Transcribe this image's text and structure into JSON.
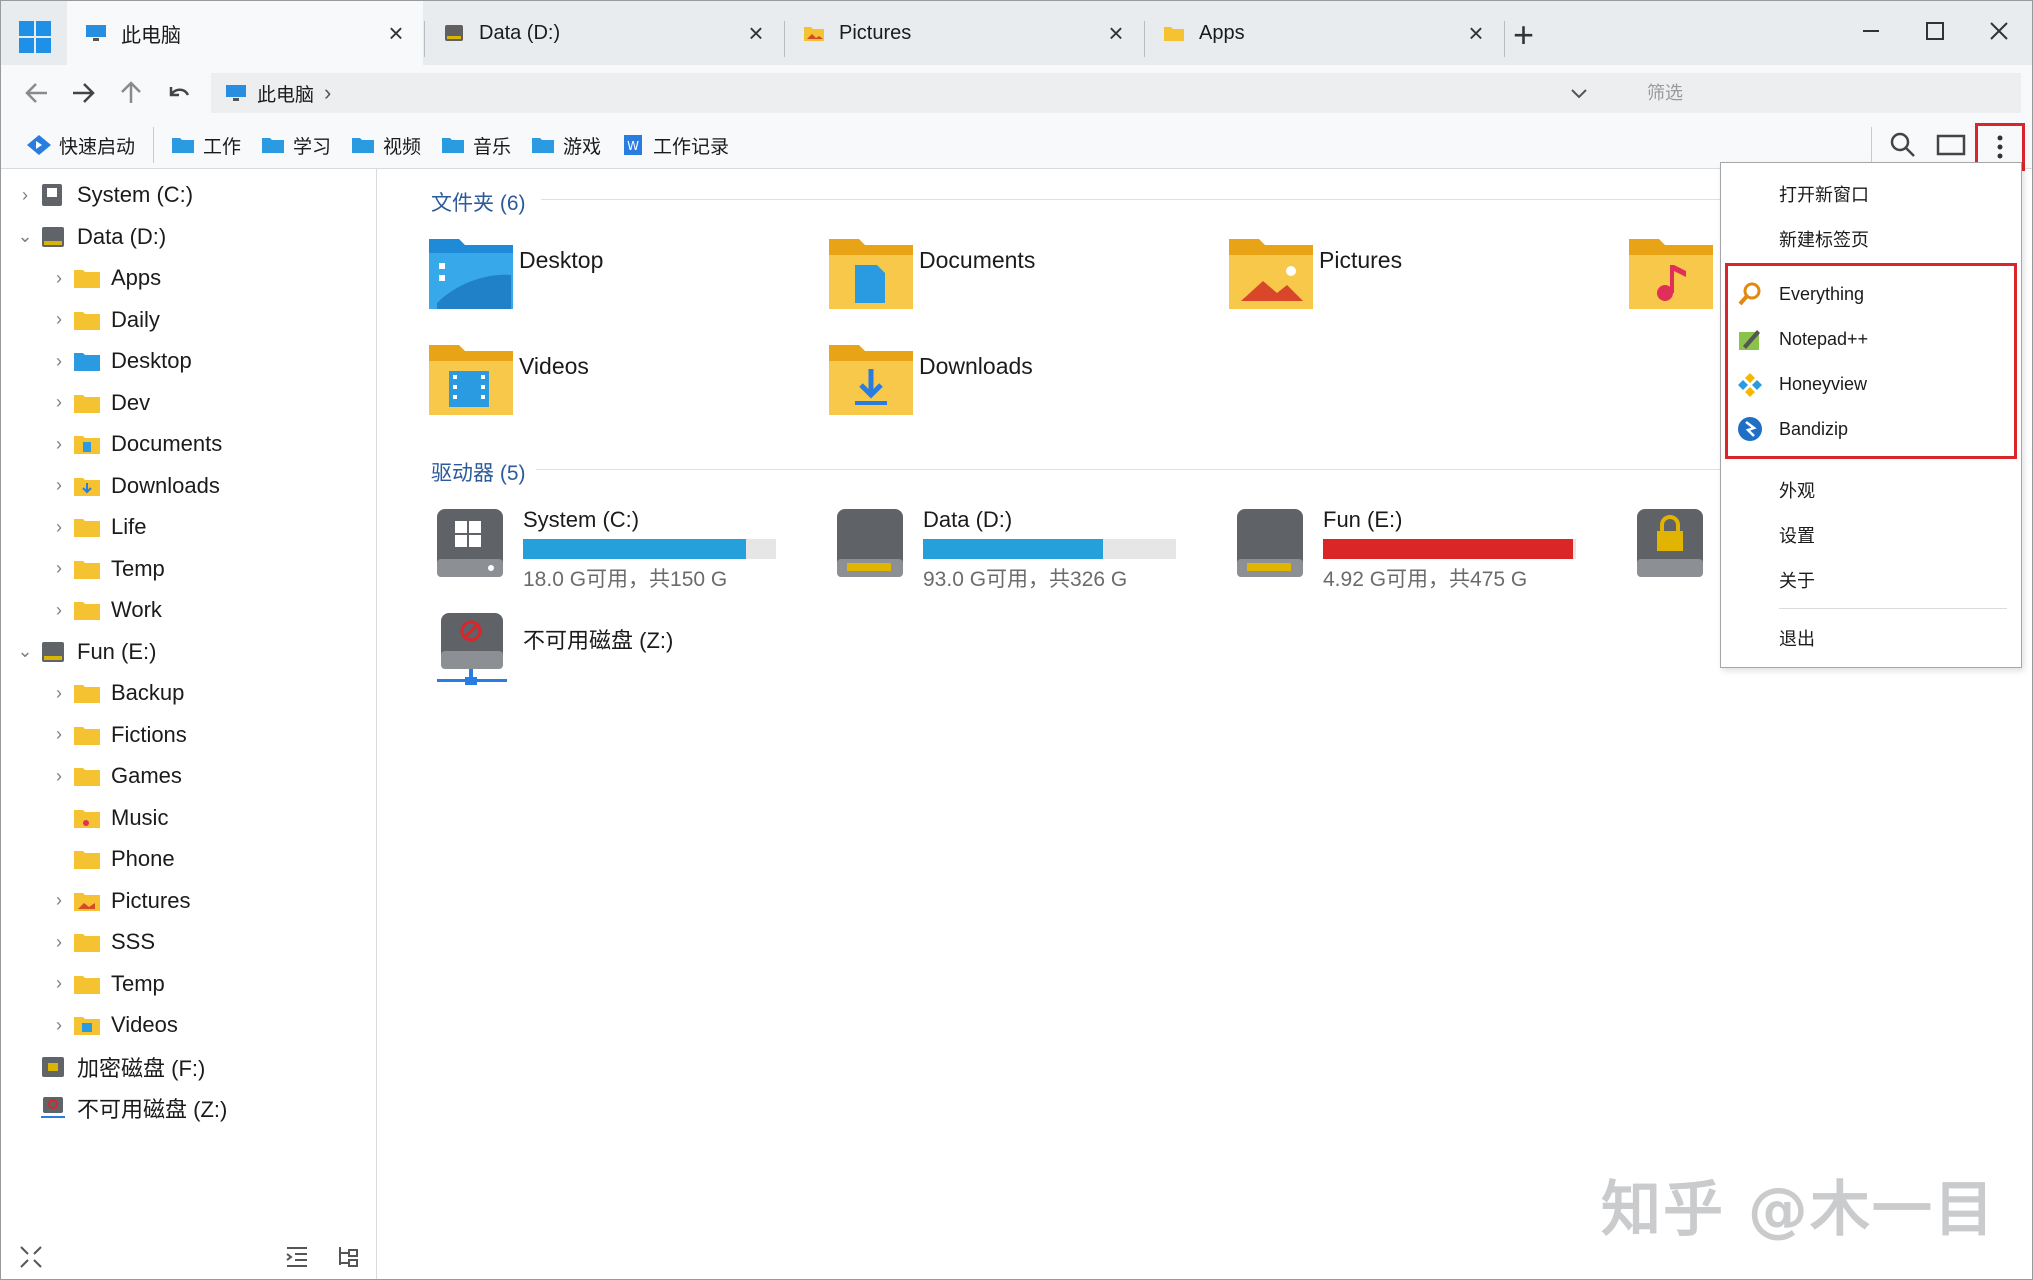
{
  "tabs": [
    {
      "label": "此电脑",
      "icon": "monitor-icon"
    },
    {
      "label": "Data (D:)",
      "icon": "drive-icon"
    },
    {
      "label": "Pictures",
      "icon": "folder-pictures-icon"
    },
    {
      "label": "Apps",
      "icon": "folder-icon"
    }
  ],
  "new_tab": "+",
  "nav": {
    "address": "此电脑",
    "filter_placeholder": "筛选"
  },
  "bookmarks": [
    "快速启动",
    "工作",
    "学习",
    "视频",
    "音乐",
    "游戏",
    "工作记录"
  ],
  "tree": {
    "drive_c": "System (C:)",
    "drive_d": "Data (D:)",
    "d_children": [
      "Apps",
      "Daily",
      "Desktop",
      "Dev",
      "Documents",
      "Downloads",
      "Life",
      "Temp",
      "Work"
    ],
    "drive_e": "Fun (E:)",
    "e_children": [
      "Backup",
      "Fictions",
      "Games",
      "Music",
      "Phone",
      "Pictures",
      "SSS",
      "Temp",
      "Videos"
    ],
    "drive_f": "加密磁盘 (F:)",
    "drive_z": "不可用磁盘 (Z:)"
  },
  "content": {
    "folders_title": "文件夹 (6)",
    "folders": [
      "Desktop",
      "Documents",
      "Pictures",
      "Videos",
      "Downloads"
    ],
    "drives_title": "驱动器 (5)",
    "drives": [
      {
        "label": "System (C:)",
        "free": "18.0 G可用，共150 G",
        "used_fraction": 0.88,
        "color": "#26a0da"
      },
      {
        "label": "Data (D:)",
        "free": "93.0 G可用，共326 G",
        "used_fraction": 0.71,
        "color": "#26a0da"
      },
      {
        "label": "Fun (E:)",
        "free": "4.92 G可用，共475 G",
        "used_fraction": 0.99,
        "color": "#da2626"
      }
    ],
    "drive_z": "不可用磁盘 (Z:)"
  },
  "menu": {
    "open_window": "打开新窗口",
    "new_tab": "新建标签页",
    "apps": [
      "Everything",
      "Notepad++",
      "Honeyview",
      "Bandizip"
    ],
    "appearance": "外观",
    "settings": "设置",
    "about": "关于",
    "exit": "退出"
  },
  "watermark": "知乎 @木一目"
}
